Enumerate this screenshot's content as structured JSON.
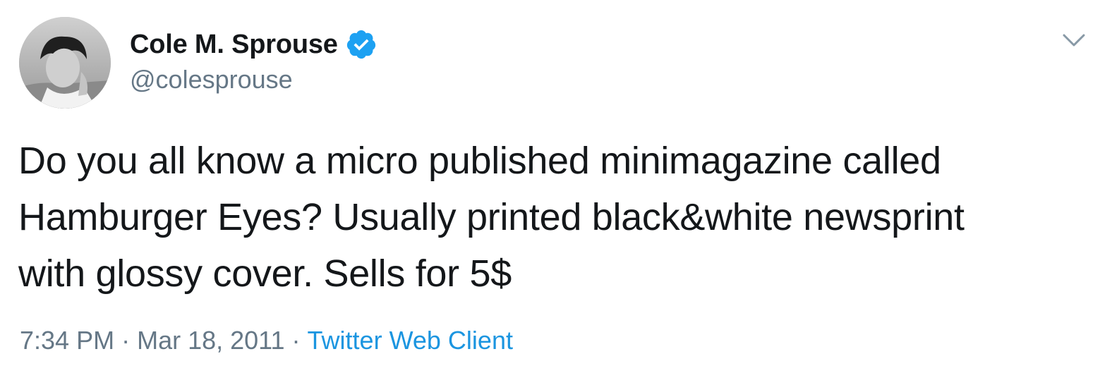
{
  "author": {
    "display_name": "Cole M. Sprouse",
    "handle": "@colesprouse",
    "verified": true
  },
  "tweet": {
    "lines": [
      "Do you all know a micro published minimagazine called",
      "Hamburger Eyes? Usually printed black&white newsprint",
      "with glossy cover. Sells for 5$"
    ],
    "time": "7:34 PM",
    "separator": "·",
    "date": "Mar 18, 2011",
    "source": "Twitter Web Client"
  },
  "icons": {
    "verified": "verified-badge-icon",
    "menu": "chevron-down-icon"
  },
  "colors": {
    "text": "#14171a",
    "secondary": "#657786",
    "link": "#1b95e0",
    "verified": "#1da1f2"
  }
}
